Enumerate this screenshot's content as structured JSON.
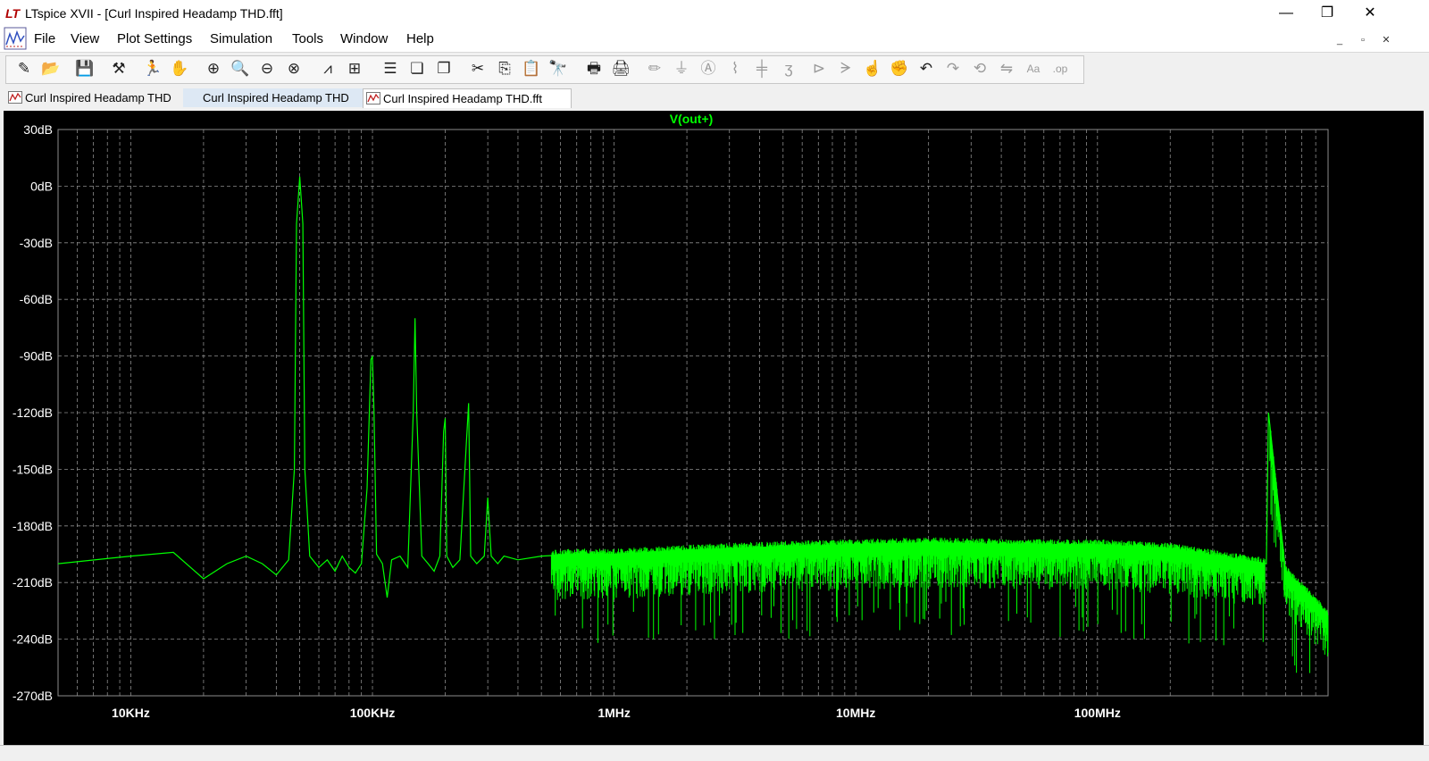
{
  "window": {
    "title": "LTspice XVII - [Curl Inspired Headamp THD.fft]",
    "logo": "LT",
    "minimize_glyph": "—",
    "restore_glyph": "❐",
    "close_glyph": "✕"
  },
  "menu": {
    "items": [
      "File",
      "View",
      "Plot Settings",
      "Simulation",
      "Tools",
      "Window",
      "Help"
    ],
    "mdi_minimize": "_",
    "mdi_restore": "▫",
    "mdi_close": "✕"
  },
  "toolbar": {
    "buttons": [
      {
        "icon": "new-schematic-icon",
        "glyph": "✎",
        "enabled": true
      },
      {
        "icon": "open-folder-icon",
        "glyph": "📂",
        "enabled": true
      },
      {
        "icon": "save-icon",
        "glyph": "💾",
        "enabled": true
      },
      {
        "icon": "control-panel-icon",
        "glyph": "⚒",
        "enabled": true
      },
      {
        "icon": "run-icon",
        "glyph": "🏃",
        "enabled": false
      },
      {
        "icon": "halt-icon",
        "glyph": "✋",
        "enabled": false
      },
      {
        "icon": "zoom-in-icon",
        "glyph": "⊕",
        "enabled": true
      },
      {
        "icon": "zoom-fit-icon",
        "glyph": "🔍",
        "enabled": true
      },
      {
        "icon": "zoom-out-icon",
        "glyph": "⊖",
        "enabled": true
      },
      {
        "icon": "zoom-cancel-icon",
        "glyph": "⊗",
        "enabled": true
      },
      {
        "icon": "autorange-icon",
        "glyph": "⩘",
        "enabled": true
      },
      {
        "icon": "manual-limits-icon",
        "glyph": "⊞",
        "enabled": true
      },
      {
        "icon": "tile-horizontal-icon",
        "glyph": "☰",
        "enabled": true
      },
      {
        "icon": "cascade-icon",
        "glyph": "❏",
        "enabled": true
      },
      {
        "icon": "tile-vertical-icon",
        "glyph": "❐",
        "enabled": true
      },
      {
        "icon": "cut-icon",
        "glyph": "✂",
        "enabled": true
      },
      {
        "icon": "copy-icon",
        "glyph": "⎘",
        "enabled": true
      },
      {
        "icon": "paste-icon",
        "glyph": "📋",
        "enabled": true
      },
      {
        "icon": "find-icon",
        "glyph": "🔭",
        "enabled": true
      },
      {
        "icon": "print-icon",
        "glyph": "🖶",
        "enabled": true
      },
      {
        "icon": "print-preview-icon",
        "glyph": "🖨",
        "enabled": true
      },
      {
        "icon": "draw-wire-icon",
        "glyph": "✏",
        "enabled": false
      },
      {
        "icon": "ground-icon",
        "glyph": "⏚",
        "enabled": false
      },
      {
        "icon": "label-net-icon",
        "glyph": "Ⓐ",
        "enabled": false
      },
      {
        "icon": "resistor-icon",
        "glyph": "⌇",
        "enabled": false
      },
      {
        "icon": "capacitor-icon",
        "glyph": "╪",
        "enabled": false
      },
      {
        "icon": "inductor-icon",
        "glyph": "ʒ",
        "enabled": false
      },
      {
        "icon": "diode-icon",
        "glyph": "⊳",
        "enabled": false
      },
      {
        "icon": "component-icon",
        "glyph": "ᗒ",
        "enabled": false
      },
      {
        "icon": "move-icon",
        "glyph": "☝",
        "enabled": false
      },
      {
        "icon": "drag-icon",
        "glyph": "✊",
        "enabled": false
      },
      {
        "icon": "undo-icon",
        "glyph": "↶",
        "enabled": true
      },
      {
        "icon": "redo-icon",
        "glyph": "↷",
        "enabled": false
      },
      {
        "icon": "rotate-icon",
        "glyph": "⟲",
        "enabled": false
      },
      {
        "icon": "mirror-icon",
        "glyph": "⇋",
        "enabled": false
      },
      {
        "icon": "text-icon",
        "glyph": "Aa",
        "enabled": false
      },
      {
        "icon": "spice-directive-icon",
        "glyph": ".op",
        "enabled": false
      }
    ]
  },
  "tabs": [
    {
      "label": "Curl Inspired Headamp THD",
      "active": false
    },
    {
      "label": "Curl Inspired Headamp THD",
      "active": false
    },
    {
      "label": "Curl Inspired Headamp THD.fft",
      "active": true
    }
  ],
  "plot": {
    "background": "#000000",
    "grid_color": "#8c8c8c",
    "trace_color": "#00ff00"
  },
  "chart_data": {
    "type": "line",
    "title": "",
    "xlabel": "",
    "ylabel": "",
    "x_scale": "log",
    "xlim": [
      5000,
      900000000
    ],
    "ylim": [
      -270,
      30
    ],
    "grid": true,
    "x_ticks": [
      {
        "value": 10000,
        "label": "10KHz"
      },
      {
        "value": 100000,
        "label": "100KHz"
      },
      {
        "value": 1000000,
        "label": "1MHz"
      },
      {
        "value": 10000000,
        "label": "10MHz"
      },
      {
        "value": 100000000,
        "label": "100MHz"
      }
    ],
    "y_ticks": [
      {
        "value": 30,
        "label": "30dB"
      },
      {
        "value": 0,
        "label": "0dB"
      },
      {
        "value": -30,
        "label": "-30dB"
      },
      {
        "value": -60,
        "label": "-60dB"
      },
      {
        "value": -90,
        "label": "-90dB"
      },
      {
        "value": -120,
        "label": "-120dB"
      },
      {
        "value": -150,
        "label": "-150dB"
      },
      {
        "value": -180,
        "label": "-180dB"
      },
      {
        "value": -210,
        "label": "-210dB"
      },
      {
        "value": -240,
        "label": "-240dB"
      },
      {
        "value": -270,
        "label": "-270dB"
      }
    ],
    "series": [
      {
        "name": "V(out+)",
        "color": "#00ff00",
        "x": [
          5000,
          10000,
          15000,
          20000,
          25000,
          30000,
          35000,
          40000,
          45000,
          47500,
          48500,
          50000,
          51500,
          52500,
          55000,
          60000,
          65000,
          70000,
          75000,
          80000,
          85000,
          90000,
          95000,
          98500,
          100000,
          101500,
          104000,
          110000,
          115000,
          120000,
          130000,
          140000,
          147500,
          150000,
          152500,
          160000,
          170000,
          180000,
          190000,
          197000,
          200000,
          203000,
          215000,
          230000,
          245000,
          250000,
          255000,
          270000,
          290000,
          300000,
          310000,
          330000,
          350000,
          400000,
          500000,
          700000,
          1000000,
          2000000,
          3000000,
          5000000,
          10000000,
          20000000,
          50000000,
          100000000,
          200000000,
          400000000,
          500000000,
          510000000,
          600000000,
          800000000,
          900000000
        ],
        "y": [
          -200,
          -196,
          -194,
          -208,
          -200,
          -196,
          -200,
          -206,
          -198,
          -150,
          -20,
          5,
          -20,
          -150,
          -196,
          -202,
          -198,
          -204,
          -196,
          -202,
          -205,
          -200,
          -160,
          -92,
          -90,
          -120,
          -195,
          -200,
          -218,
          -198,
          -196,
          -202,
          -120,
          -70,
          -120,
          -196,
          -200,
          -204,
          -196,
          -130,
          -123,
          -196,
          -202,
          -198,
          -135,
          -115,
          -196,
          -200,
          -196,
          -165,
          -196,
          -200,
          -196,
          -198,
          -196,
          -195,
          -195,
          -193,
          -192,
          -191,
          -190,
          -189,
          -190,
          -190,
          -192,
          -198,
          -200,
          -120,
          -204,
          -220,
          -228
        ]
      }
    ]
  }
}
